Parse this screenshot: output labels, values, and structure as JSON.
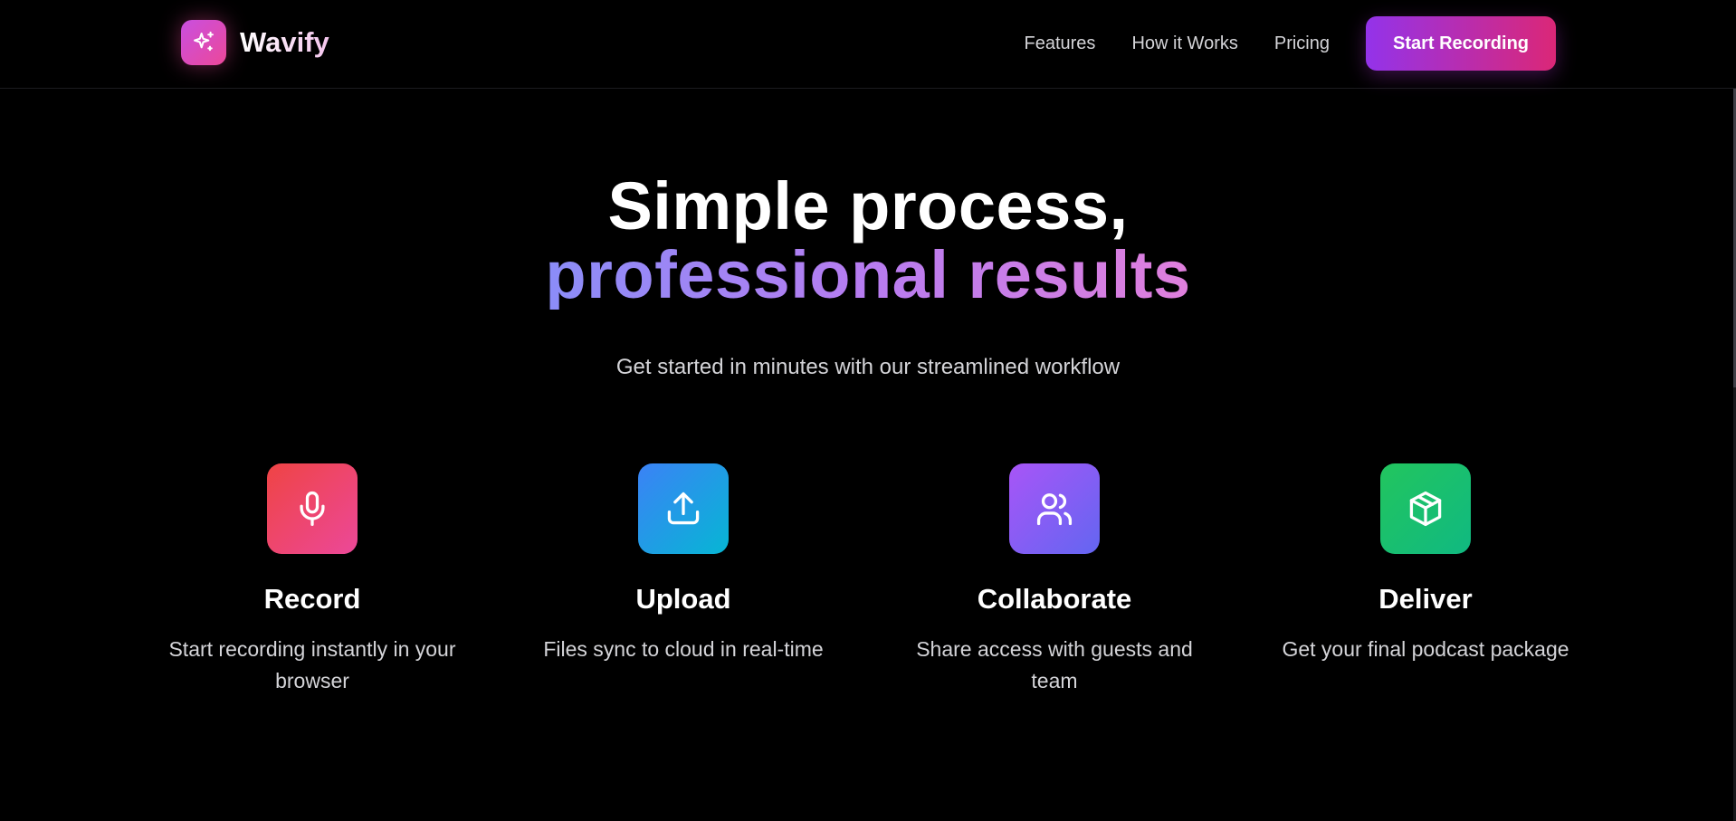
{
  "brand": {
    "name": "Wavify",
    "icon": "sparkles-icon",
    "gradient": [
      "#c94fe0",
      "#ec4899"
    ]
  },
  "nav": {
    "links": [
      "Features",
      "How it Works",
      "Pricing"
    ],
    "cta_label": "Start Recording",
    "cta_gradient": [
      "#9333ea",
      "#db2777"
    ]
  },
  "hero": {
    "title_line1": "Simple process,",
    "title_line2": "professional results",
    "subtitle": "Get started in minutes with our streamlined workflow"
  },
  "steps": [
    {
      "title": "Record",
      "description": "Start recording instantly in your browser",
      "icon": "microphone-icon",
      "colors": [
        "#ef4444",
        "#ec4899"
      ]
    },
    {
      "title": "Upload",
      "description": "Files sync to cloud in real-time",
      "icon": "upload-icon",
      "colors": [
        "#3b82f6",
        "#06b6d4"
      ]
    },
    {
      "title": "Collaborate",
      "description": "Share access with guests and team",
      "icon": "users-icon",
      "colors": [
        "#a855f7",
        "#6366f1"
      ]
    },
    {
      "title": "Deliver",
      "description": "Get your final podcast package",
      "icon": "package-icon",
      "colors": [
        "#22c55e",
        "#10b981"
      ]
    }
  ]
}
